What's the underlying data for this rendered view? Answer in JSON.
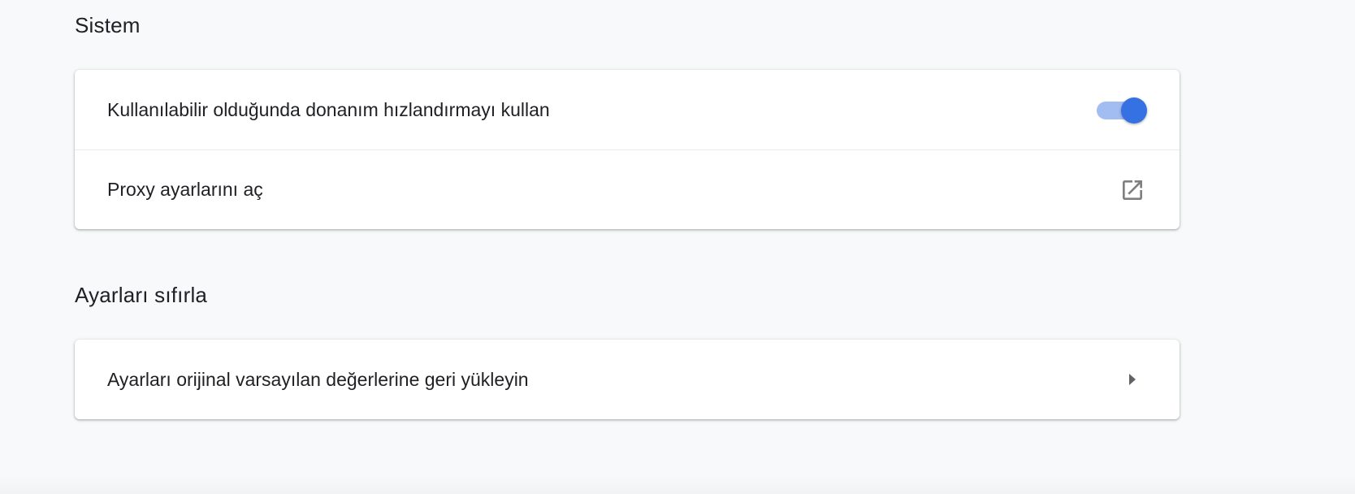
{
  "sections": [
    {
      "title": "Sistem",
      "rows": [
        {
          "label": "Kullanılabilir olduğunda donanım hızlandırmayı kullan",
          "control": "toggle",
          "toggle_on": true
        },
        {
          "label": "Proxy ayarlarını aç",
          "control": "external-link-icon"
        }
      ]
    },
    {
      "title": "Ayarları sıfırla",
      "rows": [
        {
          "label": "Ayarları orijinal varsayılan değerlerine geri yükleyin",
          "control": "arrow-right-icon"
        }
      ]
    }
  ],
  "colors": {
    "toggle_knob": "#3671e3",
    "toggle_track": "#a1bdf2",
    "icon_gray": "#7f7f7f",
    "background": "#f8f9fa"
  }
}
